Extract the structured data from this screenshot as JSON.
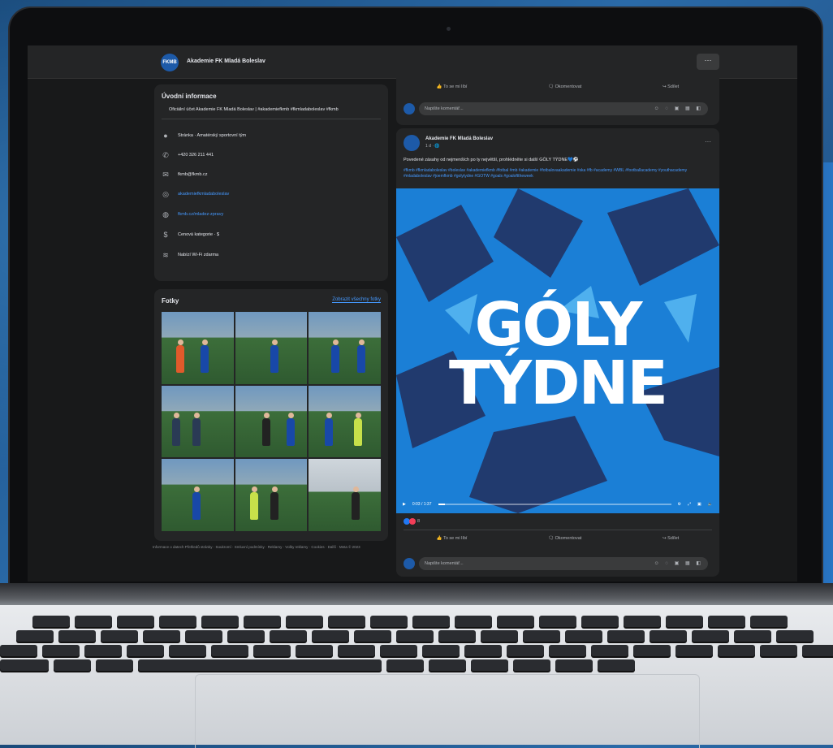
{
  "page": {
    "name": "Akademie FK Mladá Boleslav",
    "more_label": "···"
  },
  "intro": {
    "title": "Úvodní informace",
    "bio": "Oficiální účet Akademie FK Mladá Boleslav | #akademiefkmb #fkmladaboleslav #fkmb",
    "items": [
      {
        "icon": "info-icon",
        "text": "Stránka · Amatérský sportovní tým"
      },
      {
        "icon": "phone-icon",
        "text": "+420 326 211 441"
      },
      {
        "icon": "email-icon",
        "text": "fkmb@fkmb.cz"
      },
      {
        "icon": "instagram-icon",
        "text": "akademiefkmladaboleslav"
      },
      {
        "icon": "globe-icon",
        "text": "fkmb.cz/mladez-zpravy"
      },
      {
        "icon": "price-icon",
        "text": "Cenová kategorie · $"
      },
      {
        "icon": "wifi-icon",
        "text": "Nabízí Wi-Fi zdarma"
      }
    ]
  },
  "photos": {
    "title": "Fotky",
    "see_all": "Zobrazit všechny fotky"
  },
  "footer": "Informace o datech Přehledů stránky · Soukromí · Smluvní podmínky · Reklamy · Volby reklamy · Cookies · Další · Meta © 2023",
  "actions": {
    "like": "To se mi líbí",
    "comment": "Okomentovat",
    "share": "Sdílet",
    "comment_placeholder": "Napište komentář..."
  },
  "post": {
    "author": "Akademie FK Mladá Boleslav",
    "time": "1 d · 🌐",
    "text": "Povedené zásahy od nejmenších po ty největší, prohlédněte si další GÓLY TÝDNE💙⚽",
    "tags": "#fkmb #fkmladaboleslav #boleslav #akademiefkmb #fotbal #mb #akademie #fotbalovaakademie #ska #fb #academy #WBL #footballacademy #youthacademy #mladaboleslav #joemfkmb #golytydne #GOTW #goals #goalofttheweek",
    "video_title_line1": "GÓLY",
    "video_title_line2": "TÝDNE",
    "video_time": "0:03 / 1:37",
    "video_progress": 0.03,
    "reaction_count": "8"
  },
  "colors": {
    "accent": "#4599ff",
    "brand": "#1d5aa8",
    "card": "#242526"
  }
}
